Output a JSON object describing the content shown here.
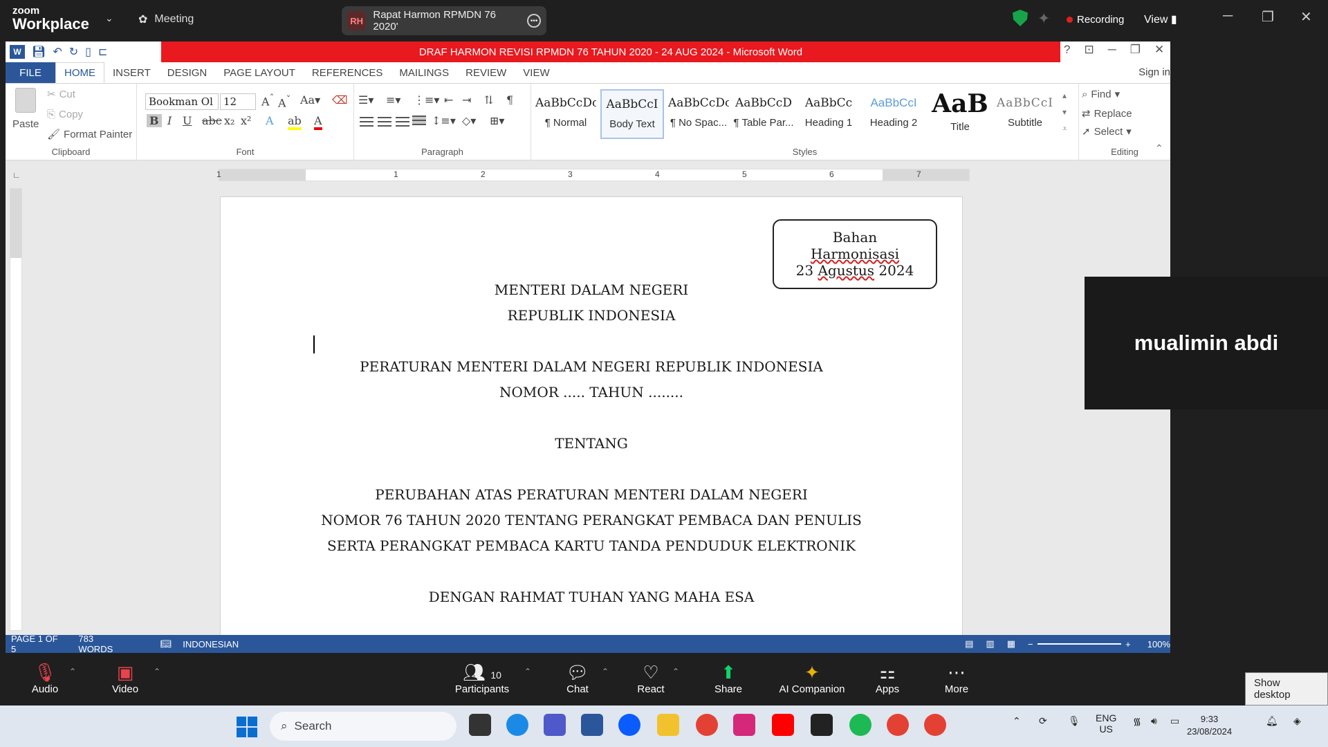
{
  "zoom_top": {
    "brand_small": "zoom",
    "brand_big": "Workplace",
    "meeting_label": "Meeting",
    "tab_badge": "RH",
    "tab_title": "Rapat Harmon RPMDN 76 2020'",
    "recording_label": "Recording",
    "view_label": "View"
  },
  "word": {
    "title": "DRAF HARMON REVISI RPMDN 76 TAHUN 2020 - 24 AUG 2024  -  Microsoft Word",
    "app_icon": "W",
    "tabs": [
      "FILE",
      "HOME",
      "INSERT",
      "DESIGN",
      "PAGE LAYOUT",
      "REFERENCES",
      "MAILINGS",
      "REVIEW",
      "VIEW"
    ],
    "sign_in": "Sign in",
    "clipboard": {
      "paste": "Paste",
      "cut": "Cut",
      "copy": "Copy",
      "format_painter": "Format Painter",
      "group": "Clipboard"
    },
    "font": {
      "name": "Bookman Ol",
      "size": "12",
      "group": "Font"
    },
    "paragraph_group": "Paragraph",
    "styles": [
      {
        "sample": "AaBbCcDc",
        "name": "¶ Normal"
      },
      {
        "sample": "AaBbCcI",
        "name": "Body Text"
      },
      {
        "sample": "AaBbCcDc",
        "name": "¶ No Spac..."
      },
      {
        "sample": "AaBbCcD",
        "name": "¶ Table Par..."
      },
      {
        "sample": "AaBbCc",
        "name": "Heading 1"
      },
      {
        "sample": "AaBbCcI",
        "name": "Heading 2"
      },
      {
        "sample": "AaB",
        "name": "Title"
      },
      {
        "sample": "AaBbCcI",
        "name": "Subtitle"
      }
    ],
    "styles_group": "Styles",
    "editing": {
      "find": "Find",
      "replace": "Replace",
      "select": "Select",
      "group": "Editing"
    },
    "ruler_numbers": [
      "1",
      "1",
      "2",
      "3",
      "4",
      "5",
      "6",
      "7"
    ],
    "document": {
      "stamp_line1": "Bahan",
      "stamp_line2": "Harmonisasi",
      "stamp_line3": "23 Agustus 2024",
      "line1": "MENTERI DALAM NEGERI",
      "line2": "REPUBLIK INDONESIA",
      "line3": "PERATURAN MENTERI DALAM NEGERI REPUBLIK INDONESIA",
      "line4": "NOMOR .....  TAHUN ........",
      "line5": "TENTANG",
      "line6": "PERUBAHAN ATAS PERATURAN MENTERI DALAM NEGERI",
      "line7": "NOMOR 76 TAHUN 2020 TENTANG PERANGKAT PEMBACA DAN PENULIS",
      "line8": "SERTA PERANGKAT PEMBACA KARTU TANDA PENDUDUK ELEKTRONIK",
      "line9": "DENGAN RAHMAT TUHAN YANG MAHA ESA"
    },
    "status": {
      "page": "PAGE 1 OF 5",
      "words": "783 WORDS",
      "language": "INDONESIAN",
      "zoom": "100%"
    },
    "colors": {
      "titlebar": "#e8191f",
      "accent": "#2b579a"
    }
  },
  "video_tile": {
    "name": "mualimin abdi"
  },
  "zoom_bottom": {
    "audio": "Audio",
    "video": "Video",
    "participants": "Participants",
    "participants_count": "10",
    "chat": "Chat",
    "react": "React",
    "share": "Share",
    "ai_companion": "AI Companion",
    "apps": "Apps",
    "more": "More",
    "show_desktop": "Show desktop"
  },
  "taskbar": {
    "search_placeholder": "Search",
    "lang_line1": "ENG",
    "lang_line2": "US",
    "time": "9:33",
    "date": "23/08/2024"
  }
}
